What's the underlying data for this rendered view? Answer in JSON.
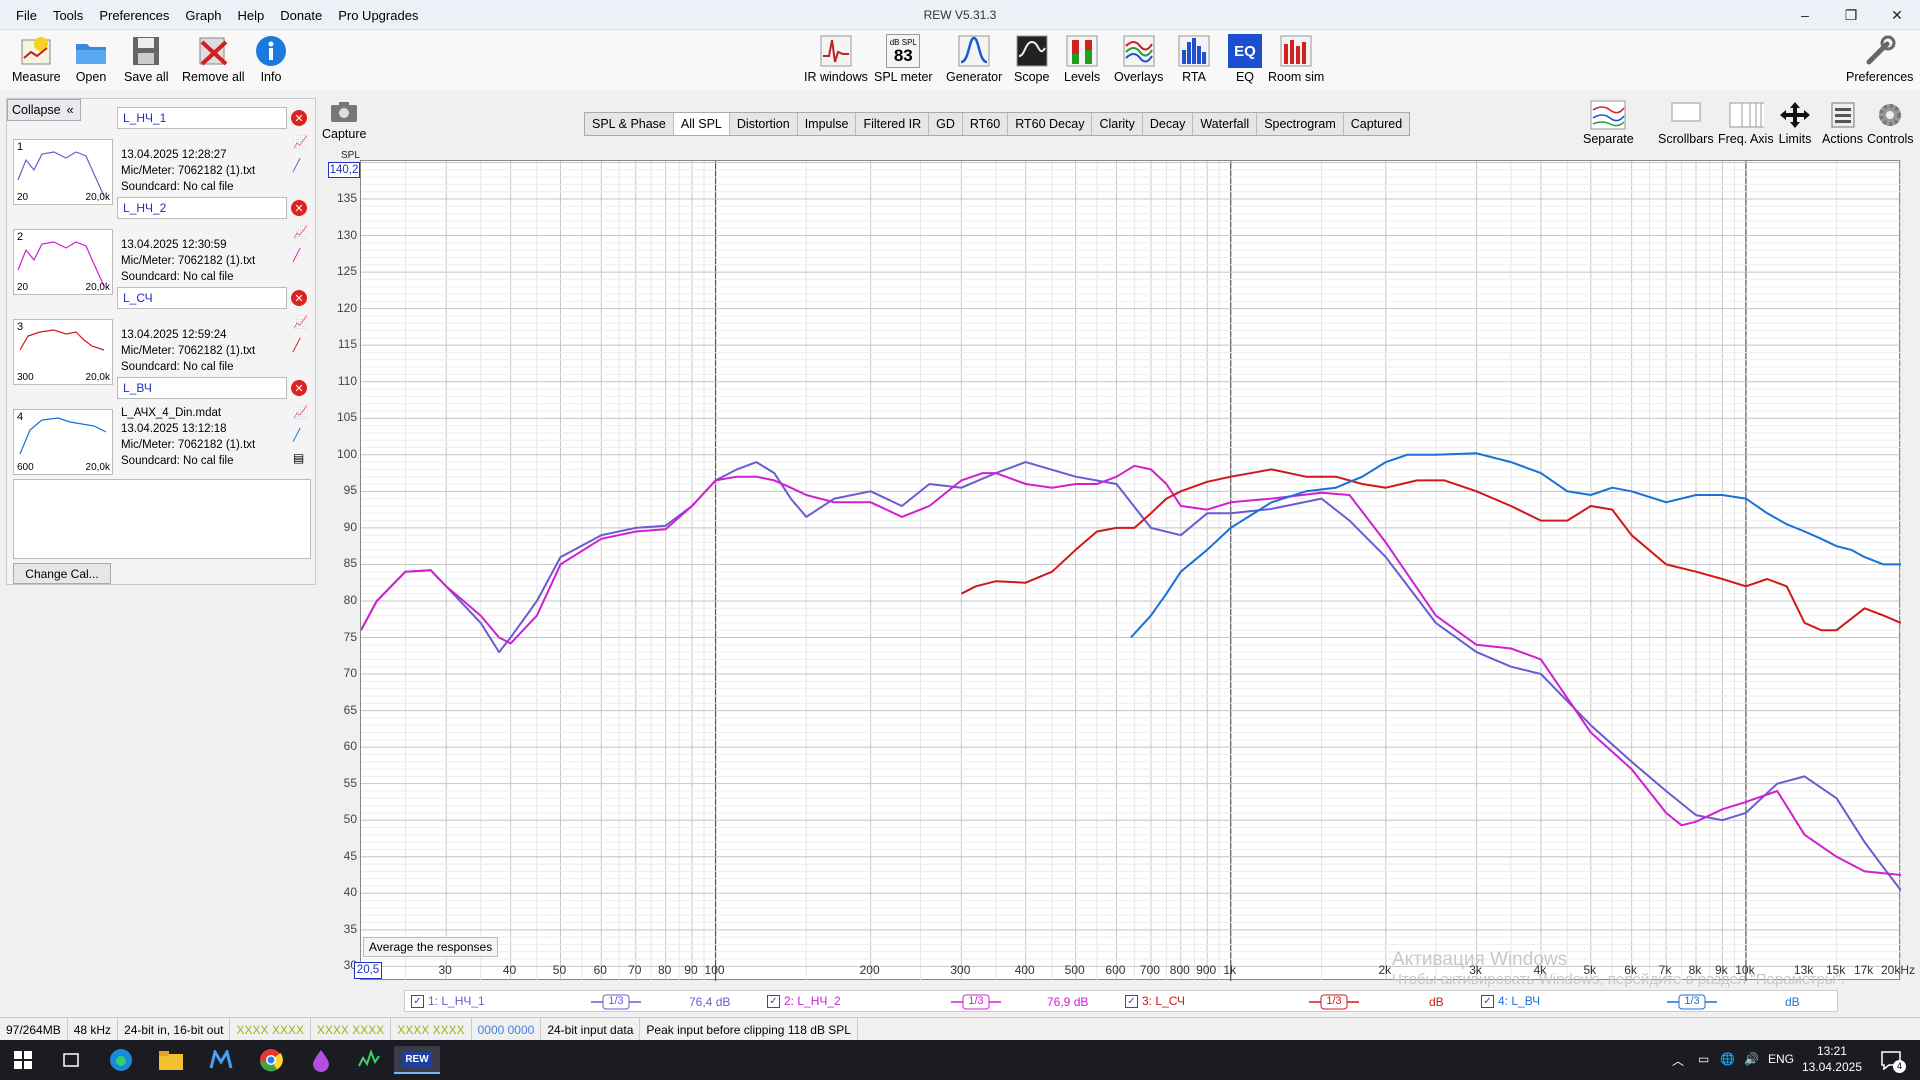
{
  "app": {
    "title": "REW V5.31.3"
  },
  "menu": [
    "File",
    "Tools",
    "Preferences",
    "Graph",
    "Help",
    "Donate",
    "Pro Upgrades"
  ],
  "window_controls": {
    "minimize": "–",
    "maximize": "❐",
    "close": "✕"
  },
  "toolbar": {
    "left": [
      "Measure",
      "Open",
      "Save all",
      "Remove all",
      "Info"
    ],
    "center": [
      "IR windows",
      "SPL meter",
      "Generator",
      "Scope",
      "Levels",
      "Overlays",
      "RTA",
      "EQ",
      "Room sim"
    ],
    "spl_meter": {
      "unit": "dB SPL",
      "value": "83"
    },
    "eq_icon_text": "EQ",
    "right": "Preferences"
  },
  "left_panel": {
    "collapse": "Collapse",
    "change_cal": "Change Cal...",
    "measurements": [
      {
        "num": "1",
        "name": "L_НЧ_1",
        "fmin": "20",
        "fmax": "20,0k",
        "lines": [
          "13.04.2025 12:28:27",
          "Mic/Meter: 7062182 (1).txt",
          "Soundcard: No cal file"
        ],
        "color": "#6a5cd0"
      },
      {
        "num": "2",
        "name": "L_НЧ_2",
        "fmin": "20",
        "fmax": "20,0k",
        "lines": [
          "13.04.2025 12:30:59",
          "Mic/Meter: 7062182 (1).txt",
          "Soundcard: No cal file"
        ],
        "color": "#d020d0"
      },
      {
        "num": "3",
        "name": "L_СЧ",
        "fmin": "300",
        "fmax": "20,0k",
        "lines": [
          "13.04.2025 12:59:24",
          "Mic/Meter: 7062182 (1).txt",
          "Soundcard: No cal file"
        ],
        "color": "#d01818"
      },
      {
        "num": "4",
        "name": "L_ВЧ",
        "fmin": "600",
        "fmax": "20,0k",
        "lines": [
          "L_АЧХ_4_Din.mdat",
          "13.04.2025 13:12:18",
          "Mic/Meter: 7062182 (1).txt",
          "Soundcard: No cal file"
        ],
        "color": "#1870d8"
      }
    ]
  },
  "capture": "Capture",
  "tabs": [
    "SPL & Phase",
    "All SPL",
    "Distortion",
    "Impulse",
    "Filtered IR",
    "GD",
    "RT60",
    "RT60 Decay",
    "Clarity",
    "Decay",
    "Waterfall",
    "Spectrogram",
    "Captured"
  ],
  "active_tab": "All SPL",
  "right_tools": [
    "Separate",
    "Scrollbars",
    "Freq. Axis",
    "Limits",
    "Actions",
    "Controls"
  ],
  "graph": {
    "y_label": "SPL",
    "y_max_box": "140,2",
    "x_min_box": "20,5",
    "average_button": "Average the responses",
    "watermark": [
      "Активация Windows",
      "Чтобы активировать Windows, перейдите в раздел \"Параметры\"."
    ],
    "y_ticks": [
      "135",
      "130",
      "125",
      "120",
      "115",
      "110",
      "105",
      "100",
      "95",
      "90",
      "85",
      "80",
      "75",
      "70",
      "65",
      "60",
      "55",
      "50",
      "45",
      "40",
      "35",
      "30"
    ],
    "x_ticks": [
      "30",
      "40",
      "50",
      "60",
      "70",
      "80",
      "90",
      "100",
      "200",
      "300",
      "400",
      "500",
      "600",
      "700",
      "800",
      "900",
      "1k",
      "2k",
      "3k",
      "4k",
      "5k",
      "6k",
      "7k",
      "8k",
      "9k",
      "10k",
      "13k",
      "15k",
      "17k",
      "20kHz"
    ]
  },
  "chart_data": {
    "type": "line",
    "xscale": "log",
    "xlim": [
      20.5,
      20000
    ],
    "ylim": [
      28,
      140.2
    ],
    "xlabel": "",
    "ylabel": "SPL",
    "grid": true,
    "series": [
      {
        "name": "1: L_НЧ_1",
        "color": "#6a5cd0",
        "x": [
          20.5,
          22,
          25,
          28,
          30,
          35,
          38,
          40,
          45,
          50,
          60,
          70,
          80,
          90,
          100,
          110,
          120,
          130,
          140,
          150,
          170,
          200,
          230,
          260,
          300,
          350,
          400,
          500,
          600,
          700,
          800,
          900,
          1000,
          1200,
          1500,
          1700,
          2000,
          2500,
          3000,
          3500,
          4000,
          5000,
          6000,
          7000,
          8000,
          9000,
          10000,
          11500,
          13000,
          15000,
          17000,
          18500,
          20000
        ],
        "y": [
          76,
          80,
          84,
          84.2,
          82,
          77,
          73,
          75,
          80,
          86,
          89,
          90,
          90.3,
          93,
          96.5,
          98,
          99,
          97.5,
          94,
          91.5,
          94,
          95,
          93,
          96,
          95.5,
          97.5,
          99,
          97,
          96,
          90,
          89,
          92,
          92,
          92.6,
          94,
          91,
          86,
          77,
          73,
          71,
          70,
          63,
          58,
          54,
          50.7,
          50,
          51,
          55,
          56,
          53,
          47,
          43.5,
          40.4
        ]
      },
      {
        "name": "2: L_НЧ_2",
        "color": "#d020d0",
        "x": [
          20.5,
          22,
          25,
          28,
          30,
          35,
          38,
          40,
          45,
          50,
          60,
          70,
          80,
          90,
          100,
          110,
          120,
          130,
          140,
          150,
          170,
          200,
          230,
          260,
          300,
          330,
          350,
          400,
          450,
          500,
          550,
          600,
          650,
          700,
          750,
          800,
          900,
          1000,
          1200,
          1500,
          1700,
          2000,
          2500,
          3000,
          3500,
          4000,
          5000,
          6000,
          7000,
          7500,
          8000,
          9000,
          10000,
          11500,
          13000,
          15000,
          17000,
          20000
        ],
        "y": [
          76,
          80,
          84,
          84.2,
          82,
          78,
          75,
          74.2,
          78,
          85,
          88.5,
          89.5,
          89.8,
          93,
          96.5,
          97,
          97,
          96.5,
          95.5,
          94.5,
          93.5,
          93.5,
          91.5,
          93,
          96.5,
          97.5,
          97.5,
          96,
          95.5,
          96,
          96,
          97,
          98.5,
          98,
          96,
          93,
          92.5,
          93.5,
          94,
          94.8,
          94.5,
          88,
          78,
          74,
          73.5,
          72,
          62,
          57,
          51,
          49.3,
          49.8,
          51.5,
          52.5,
          54,
          48,
          45,
          43,
          42.5
        ]
      },
      {
        "name": "3: L_СЧ",
        "color": "#d01818",
        "x": [
          300,
          320,
          350,
          400,
          450,
          500,
          550,
          600,
          650,
          700,
          750,
          800,
          900,
          1000,
          1200,
          1400,
          1600,
          1800,
          2000,
          2300,
          2600,
          3000,
          3500,
          4000,
          4500,
          5000,
          5500,
          6000,
          7000,
          8000,
          9000,
          10000,
          11000,
          12000,
          13000,
          14000,
          15000,
          17000,
          18500,
          20000
        ],
        "y": [
          81,
          82,
          82.7,
          82.5,
          84,
          87,
          89.5,
          90,
          90,
          92,
          94,
          95,
          96.3,
          97,
          98,
          97,
          97,
          96,
          95.5,
          96.5,
          96.5,
          95,
          93,
          91,
          91,
          93,
          92.5,
          89,
          85,
          84,
          83,
          82,
          83,
          82,
          77,
          76,
          76,
          79,
          78,
          77
        ]
      },
      {
        "name": "4: L_ВЧ",
        "color": "#1870d8",
        "x": [
          640,
          700,
          750,
          800,
          900,
          1000,
          1200,
          1400,
          1600,
          1800,
          2000,
          2200,
          2500,
          3000,
          3500,
          4000,
          4500,
          5000,
          5500,
          6000,
          7000,
          8000,
          9000,
          10000,
          11000,
          12000,
          13000,
          14000,
          15000,
          16000,
          17000,
          18500,
          20000
        ],
        "y": [
          75,
          78,
          81,
          84,
          87,
          90,
          93.5,
          95,
          95.5,
          97,
          99,
          100,
          100,
          100.2,
          99,
          97.5,
          95,
          94.5,
          95.5,
          95,
          93.5,
          94.5,
          94.5,
          94,
          92,
          90.5,
          89.5,
          88.5,
          87.5,
          87,
          86,
          85,
          85
        ]
      }
    ]
  },
  "legend": {
    "items": [
      {
        "label": "1: L_НЧ_1",
        "color": "#6a5cd0",
        "smoothing": "1/3",
        "value": "76,4 dB"
      },
      {
        "label": "2: L_НЧ_2",
        "color": "#d020d0",
        "smoothing": "1/3",
        "value": "76,9 dB"
      },
      {
        "label": "3: L_СЧ",
        "color": "#d01818",
        "smoothing": "1/3",
        "value": "dB"
      },
      {
        "label": "4: L_ВЧ",
        "color": "#1870d8",
        "smoothing": "1/3",
        "value": "dB"
      }
    ]
  },
  "status": {
    "memory": "97/264MB",
    "rate": "48 kHz",
    "bits": "24-bit in, 16-bit out",
    "meter1": "XXXX XXXX",
    "meter2": "XXXX XXXX",
    "meter3": "XXXX XXXX",
    "meter4": "0000 0000",
    "input": "24-bit input data",
    "peak": "Peak input before clipping 118 dB SPL"
  },
  "taskbar": {
    "lang": "ENG",
    "time": "13:21",
    "date": "13.04.2025",
    "notifications": "4",
    "rew_label": "REW"
  }
}
